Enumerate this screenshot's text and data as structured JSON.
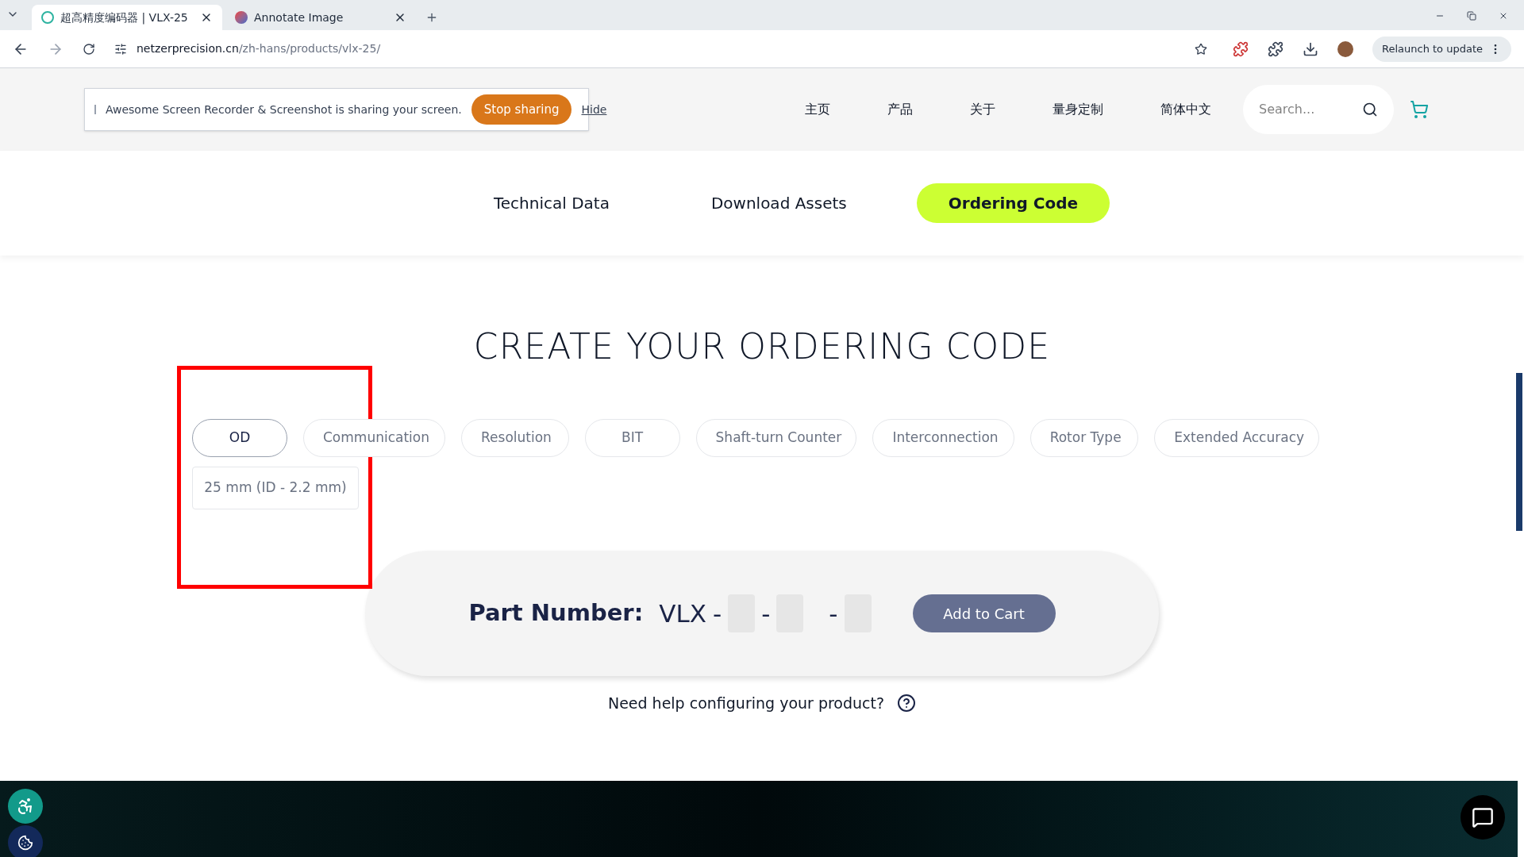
{
  "browser": {
    "tabs": [
      {
        "title": "超高精度编码器 | VLX-25",
        "selected": true
      },
      {
        "title": "Annotate Image",
        "selected": false
      }
    ],
    "address_host": "netzerprecision.cn",
    "address_path": "/zh-hans/products/vlx-25/",
    "relaunch": "Relaunch to update"
  },
  "share_bar": {
    "text": "Awesome Screen Recorder & Screenshot is sharing your screen.",
    "stop": "Stop sharing",
    "hide": "Hide"
  },
  "nav": {
    "items": [
      "主页",
      "产品",
      "关于",
      "量身定制",
      "简体中文"
    ],
    "search_placeholder": "Search..."
  },
  "subnav": [
    {
      "label": "Technical Data",
      "selected": false
    },
    {
      "label": "Download Assets",
      "selected": false
    },
    {
      "label": "Ordering Code",
      "selected": true
    }
  ],
  "heading": "CREATE YOUR ORDERING CODE",
  "options": {
    "tabs": [
      {
        "label": "OD",
        "selected": true
      },
      {
        "label": "Communication",
        "selected": false
      },
      {
        "label": "Resolution",
        "selected": false
      },
      {
        "label": "BIT",
        "selected": false
      },
      {
        "label": "Shaft-turn Counter",
        "selected": false
      },
      {
        "label": "Interconnection",
        "selected": false
      },
      {
        "label": "Rotor Type",
        "selected": false
      },
      {
        "label": "Extended Accuracy",
        "selected": false
      }
    ],
    "values": [
      "25 mm (ID - 2.2 mm)"
    ]
  },
  "part_number": {
    "label": "Part Number:",
    "prefix": "VLX",
    "separators": [
      "-",
      "-",
      "-"
    ],
    "add_to_cart": "Add to Cart"
  },
  "help": "Need help configuring your product?"
}
